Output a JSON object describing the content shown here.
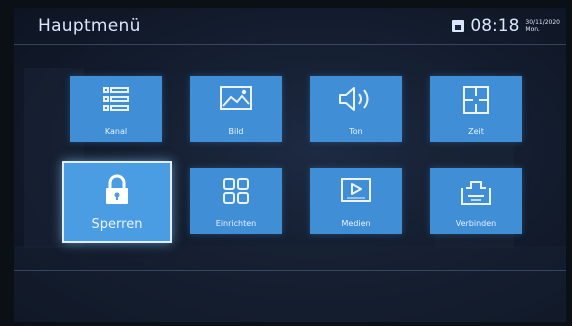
{
  "header": {
    "title": "Hauptmenü",
    "time": "08:18",
    "date": "30/11/2020",
    "day": "Mon."
  },
  "tiles": [
    {
      "label": "Kanal",
      "icon": "list-icon"
    },
    {
      "label": "Bild",
      "icon": "picture-icon"
    },
    {
      "label": "Ton",
      "icon": "speaker-icon"
    },
    {
      "label": "Zeit",
      "icon": "clock-icon"
    },
    {
      "label": "Sperren",
      "icon": "lock-icon",
      "selected": true
    },
    {
      "label": "Einrichten",
      "icon": "grid-icon"
    },
    {
      "label": "Medien",
      "icon": "media-icon"
    },
    {
      "label": "Verbinden",
      "icon": "connect-icon"
    }
  ],
  "colors": {
    "tile": "#3f8ed6",
    "tile_selected_border": "#dfeeff",
    "background": "#131c2d"
  }
}
